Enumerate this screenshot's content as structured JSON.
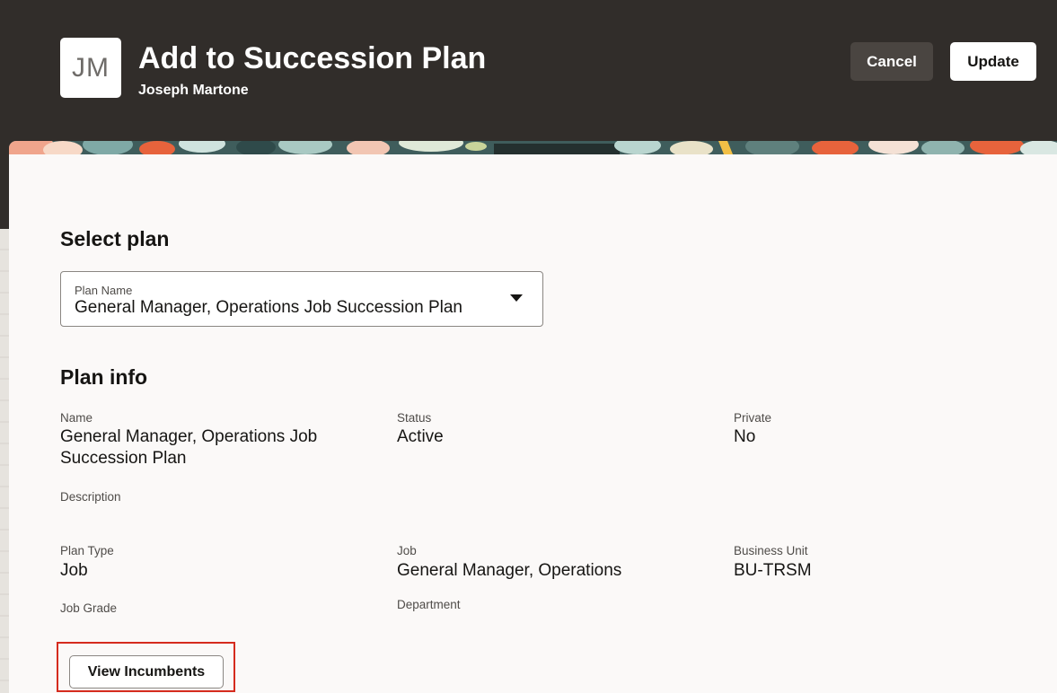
{
  "header": {
    "avatar_initials": "JM",
    "title": "Add to Succession Plan",
    "subtitle": "Joseph Martone",
    "cancel_label": "Cancel",
    "update_label": "Update"
  },
  "select_plan": {
    "section_title": "Select plan",
    "field_label": "Plan Name",
    "selected_value": "General Manager, Operations Job Succession Plan"
  },
  "plan_info": {
    "section_title": "Plan info",
    "name_label": "Name",
    "name_value_line1": "General Manager, Operations Job",
    "name_value_line2": "Succession Plan",
    "status_label": "Status",
    "status_value": "Active",
    "private_label": "Private",
    "private_value": "No",
    "description_label": "Description",
    "plan_type_label": "Plan Type",
    "plan_type_value": "Job",
    "job_label": "Job",
    "job_value": "General Manager, Operations",
    "business_unit_label": "Business Unit",
    "business_unit_value": "BU-TRSM",
    "job_grade_label": "Job Grade",
    "department_label": "Department",
    "view_incumbents_label": "View Incumbents"
  },
  "colors": {
    "header_bg": "#312d2a",
    "panel_bg": "#fbf9f8",
    "highlight": "#d52b1e"
  }
}
